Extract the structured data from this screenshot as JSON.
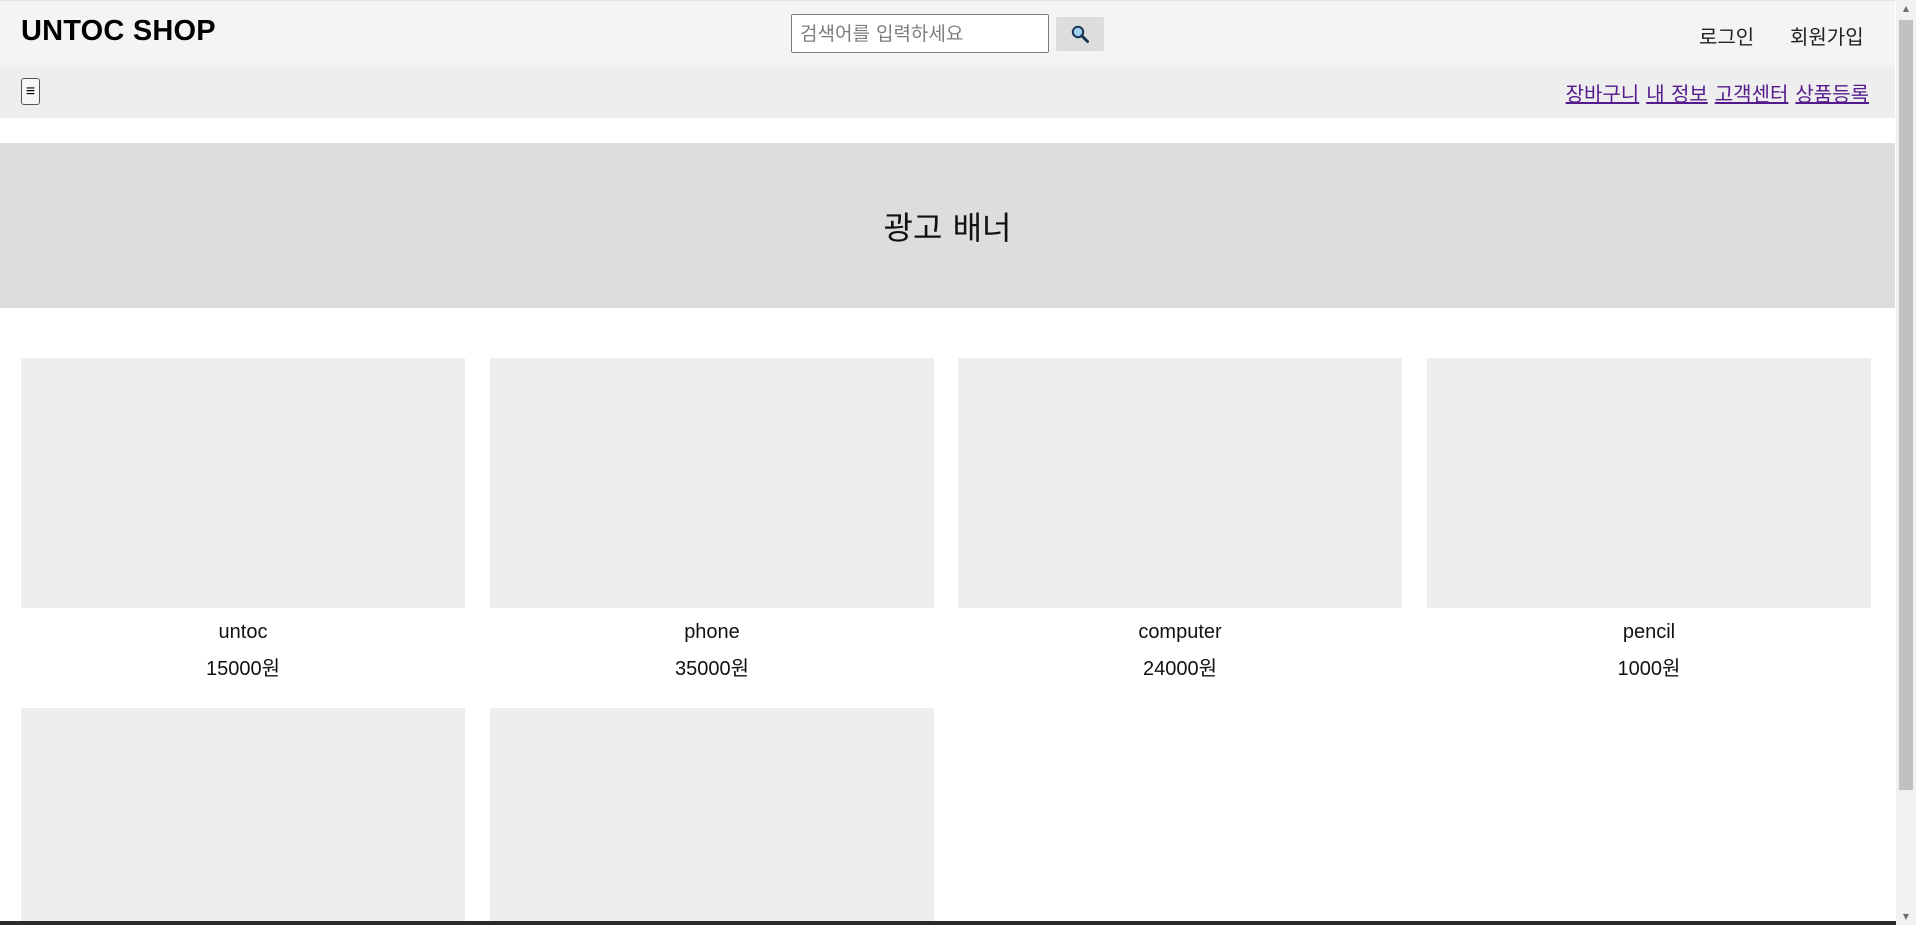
{
  "header": {
    "logo": "UNTOC SHOP",
    "search_placeholder": "검색어를 입력하세요",
    "search_icon": "magnifier-icon",
    "login_label": "로그인",
    "signup_label": "회원가입"
  },
  "subnav": {
    "menu_icon": "≡",
    "links": [
      {
        "label": "장바구니"
      },
      {
        "label": "내 정보"
      },
      {
        "label": "고객센터"
      },
      {
        "label": "상품등록"
      }
    ],
    "link_color": "#551a8b"
  },
  "banner": {
    "text": "광고 배너"
  },
  "products": [
    {
      "name": "untoc",
      "price": "15000원"
    },
    {
      "name": "phone",
      "price": "35000원"
    },
    {
      "name": "computer",
      "price": "24000원"
    },
    {
      "name": "pencil",
      "price": "1000원"
    },
    {
      "name": "",
      "price": ""
    },
    {
      "name": "",
      "price": ""
    }
  ],
  "colors": {
    "header_bg": "#f4f4f4",
    "subnav_bg": "#eeeeee",
    "banner_bg": "#dddddd",
    "product_image_bg": "#eeeeee"
  }
}
